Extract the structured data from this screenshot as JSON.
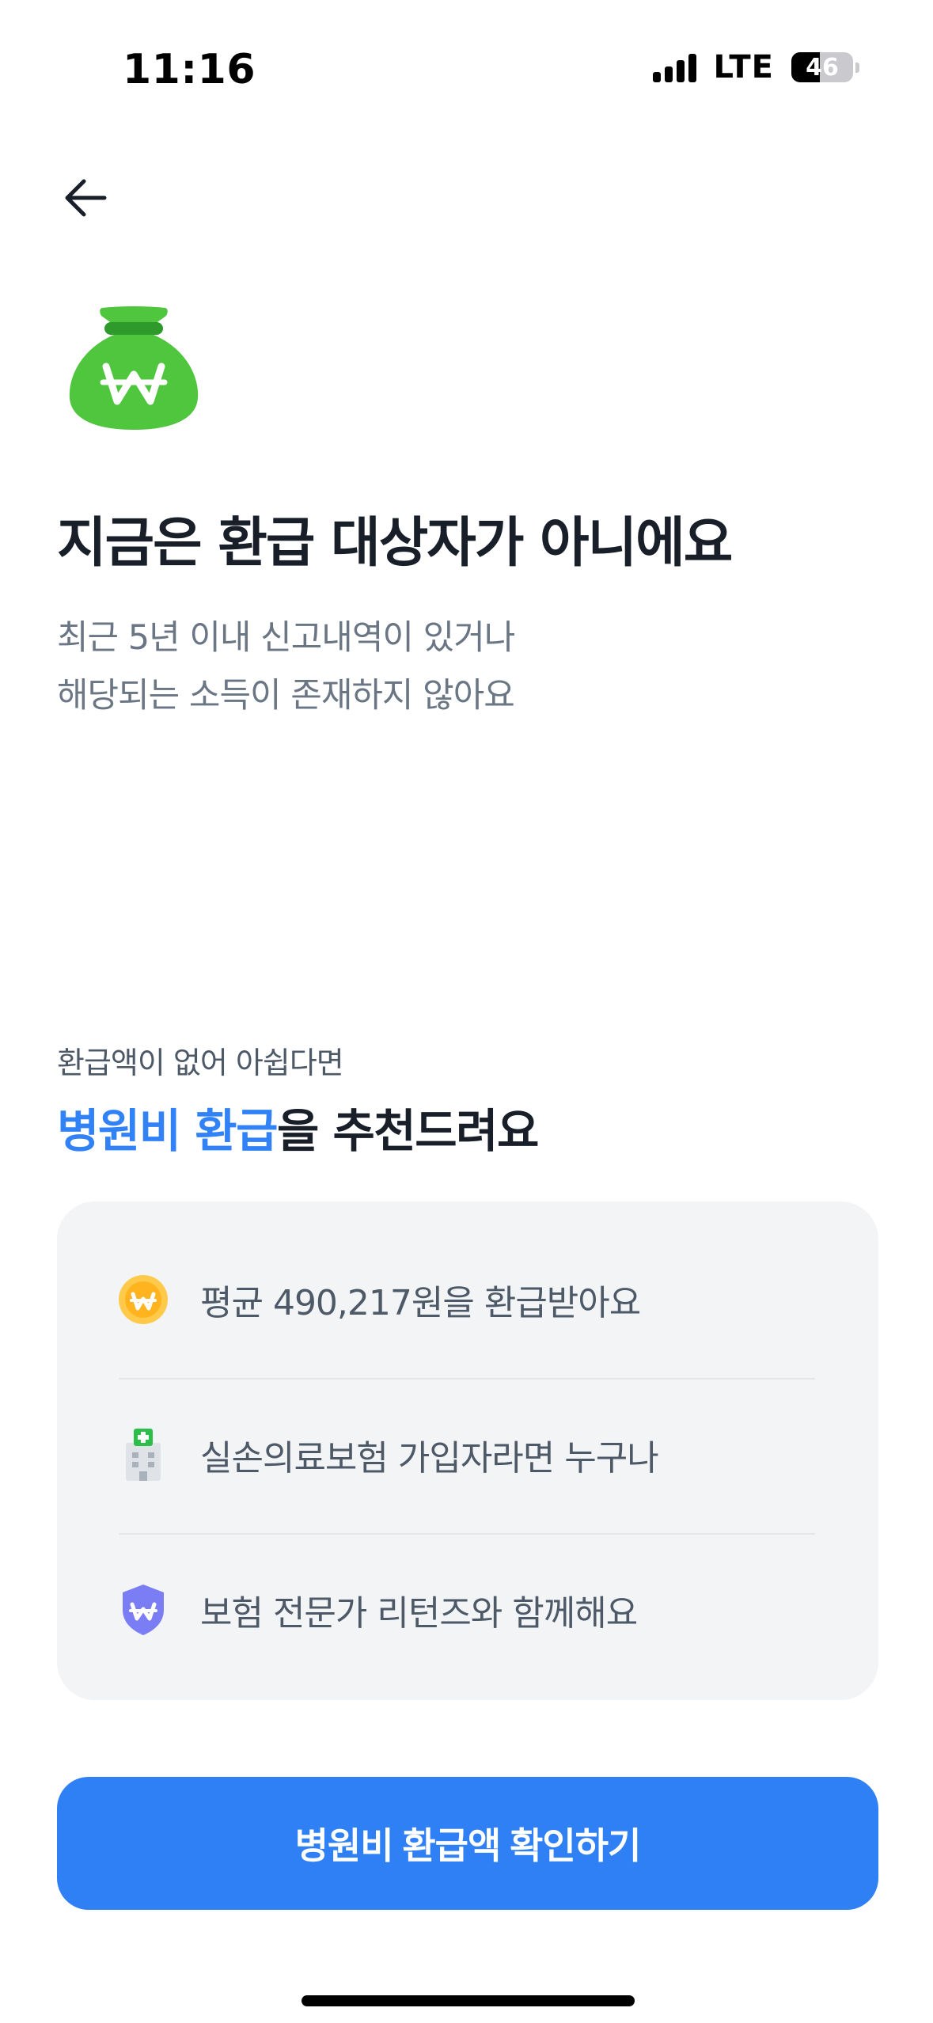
{
  "status_bar": {
    "time": "11:16",
    "network": "LTE",
    "battery_percent": "46"
  },
  "header": {
    "back_icon": "arrow-left-icon"
  },
  "hero": {
    "icon": "money-bag-icon",
    "title": "지금은 환급 대상자가 아니에요",
    "subtitle_lines": [
      "최근 5년 이내 신고내역이 있거나",
      "해당되는 소득이 존재하지 않아요"
    ]
  },
  "recommendation": {
    "small_text": "환급액이 없어 아쉽다면",
    "title_highlight": "병원비 환급",
    "title_rest": "을 추천드려요",
    "items": [
      {
        "icon": "won-coin-icon",
        "text": "평균 490,217원을 환급받아요"
      },
      {
        "icon": "hospital-icon",
        "text": "실손의료보험 가입자라면 누구나"
      },
      {
        "icon": "shield-won-icon",
        "text": "보험 전문가 리턴즈와 함께해요"
      }
    ]
  },
  "cta": {
    "label": "병원비 환급액 확인하기"
  },
  "colors": {
    "accent": "#3182f6",
    "button": "#2f7ff5",
    "bag_green": "#4fc63e",
    "card_bg": "#f2f4f6"
  }
}
